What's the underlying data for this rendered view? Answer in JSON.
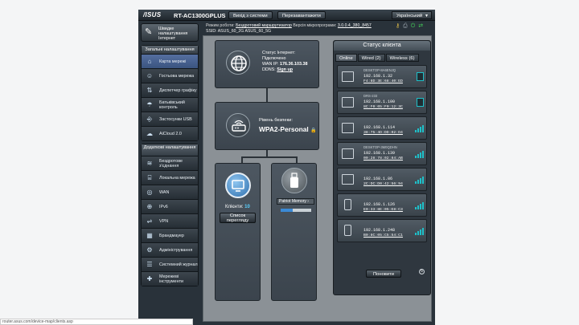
{
  "header": {
    "brand": "/ISUS",
    "model": "RT-AC1300GPLUS",
    "logout_label": "Вихід з системи",
    "reboot_label": "Перезавантажити",
    "language": "Український"
  },
  "status": {
    "mode_label": "Режим роботи:",
    "mode_value": "Бездротовий маршрутизатор",
    "fw_label": "Версія мікропрограми:",
    "fw_value": "3.0.0.4_380_8457",
    "ssid_label": "SSID:",
    "ssid_1": "ASUS_60_2G",
    "ssid_2": "ASUS_60_5G"
  },
  "sidebar": {
    "quick_setup": "Швидке налаштування Інтернет",
    "general_header": "Загальні налаштування",
    "general_items": [
      {
        "label": "Карта мережі",
        "icon": "network-map-icon"
      },
      {
        "label": "Гостьова мережа",
        "icon": "guest-network-icon"
      },
      {
        "label": "Диспетчер графіку",
        "icon": "traffic-manager-icon"
      },
      {
        "label": "Батьківський контроль",
        "icon": "parental-control-icon"
      },
      {
        "label": "Застосунки USB",
        "icon": "usb-icon"
      },
      {
        "label": "AiCloud 2.0",
        "icon": "cloud-icon"
      }
    ],
    "advanced_header": "Додаткові налаштування",
    "advanced_items": [
      {
        "label": "Бездротове з'єднання",
        "icon": "wireless-icon"
      },
      {
        "label": "Локальна мережа",
        "icon": "lan-icon"
      },
      {
        "label": "WAN",
        "icon": "wan-icon"
      },
      {
        "label": "IPv6",
        "icon": "ipv6-icon"
      },
      {
        "label": "VPN",
        "icon": "vpn-icon"
      },
      {
        "label": "Брандмауер",
        "icon": "firewall-icon"
      },
      {
        "label": "Адміністрування",
        "icon": "admin-icon"
      },
      {
        "label": "Системний журнал",
        "icon": "log-icon"
      },
      {
        "label": "Мережеві інструменти",
        "icon": "tools-icon"
      }
    ]
  },
  "map": {
    "internet_status_label": "Статус Інтернет:",
    "internet_status": "Підключено",
    "wan_ip_label": "WAN IP:",
    "wan_ip": "176.36.103.38",
    "ddns_label": "DDNS:",
    "ddns_link": "Sign up",
    "security_label": "Рівень безпеки:",
    "security_value": "WPA2-Personal",
    "clients_label": "Клієнти:",
    "clients_count": "10",
    "view_list_label": "Список перегляду",
    "usb_name": "Patriot Memory",
    "usb_fill": 0.4
  },
  "client_status": {
    "title": "Статус клієнта",
    "tabs": [
      "Online",
      "Wired (2)",
      "Wireless (6)"
    ],
    "refresh_label": "Поновити",
    "clients": [
      {
        "name": "DESKTOP-8A6ENJQ",
        "ip": "192.168.1.32",
        "mac": "F4:8D:3E:68:40:ED",
        "device": "pc",
        "conn": "wired"
      },
      {
        "name": "DRS-233",
        "ip": "192.168.1.100",
        "mac": "8C:F0:05:F0:12:3C",
        "device": "pc",
        "conn": "wired"
      },
      {
        "name": "",
        "ip": "192.168.1.114",
        "mac": "38:75:4D:DD:02:D4",
        "device": "pc",
        "conn": "wifi"
      },
      {
        "name": "DESKTOP-3M0QDHN",
        "ip": "192.168.1.139",
        "mac": "00:28:78:02:84:AB",
        "device": "pc",
        "conn": "wifi"
      },
      {
        "name": "",
        "ip": "192.168.1.86",
        "mac": "2C:DC:D0:42:56:94",
        "device": "pc",
        "conn": "wifi"
      },
      {
        "name": "",
        "ip": "192.168.1.126",
        "mac": "E0:33:8E:05:E8:C3",
        "device": "phone",
        "conn": "wifi"
      },
      {
        "name": "",
        "ip": "192.168.1.248",
        "mac": "B0:8C:05:C5:54:C1",
        "device": "phone",
        "conn": "wifi"
      }
    ]
  },
  "statusbar": "router.asus.com/device-map/clients.asp"
}
